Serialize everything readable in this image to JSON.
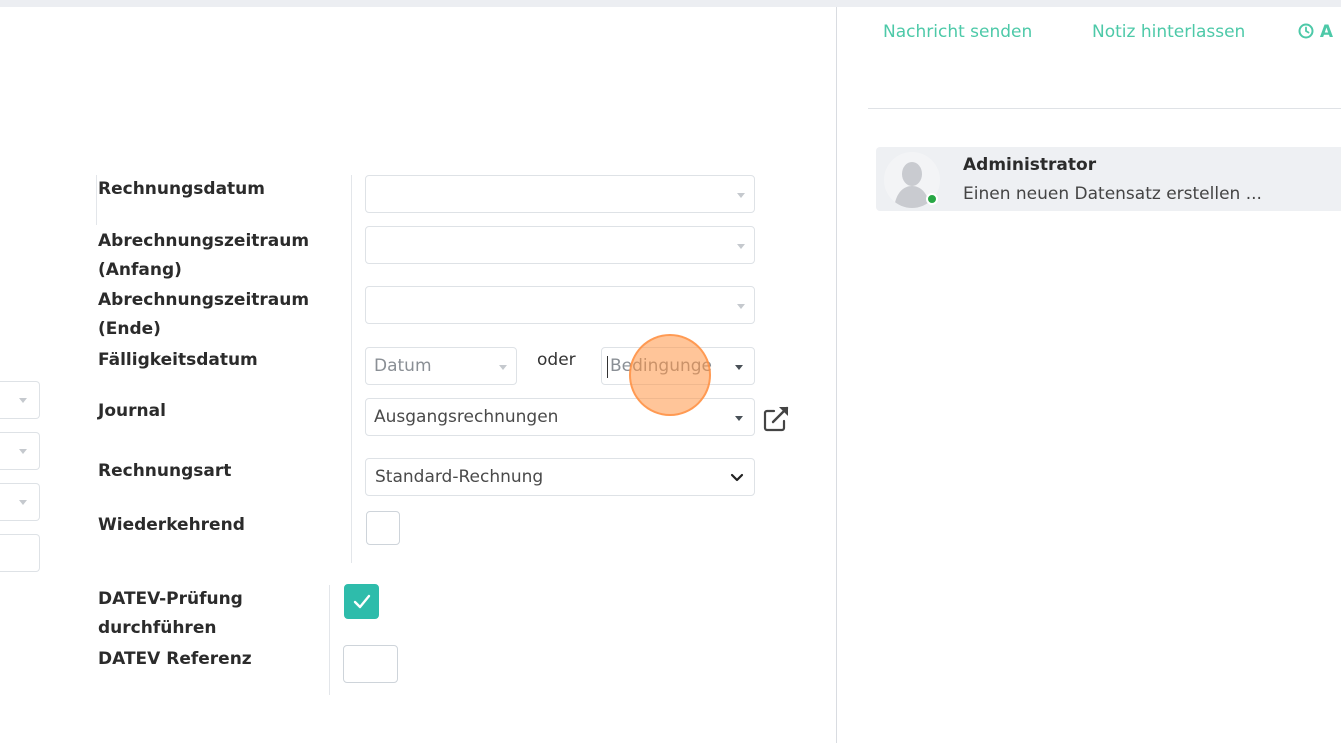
{
  "form": {
    "labels": {
      "invoice_date": "Rechnungsdatum",
      "period_start_1": "Abrechnungszeitraum",
      "period_start_2": "(Anfang)",
      "period_end_1": "Abrechnungszeitraum",
      "period_end_2": "(Ende)",
      "due_date": "Fälligkeitsdatum",
      "journal": "Journal",
      "invoice_type": "Rechnungsart",
      "recurring": "Wiederkehrend",
      "datev_check_1": "DATEV-Prüfung",
      "datev_check_2": "durchführen",
      "datev_ref": "DATEV Referenz"
    },
    "due_date": {
      "date_placeholder": "Datum",
      "or_text": "oder",
      "terms_placeholder": "Bedingunge"
    },
    "journal_value": "Ausgangsrechnungen",
    "invoice_type_value": "Standard-Rechnung",
    "recurring_checked": false,
    "datev_check_checked": true,
    "datev_ref_value": ""
  },
  "chatter": {
    "buttons": {
      "send_message": "Nachricht senden",
      "log_note": "Notiz hinterlassen",
      "activity": "A"
    },
    "messages": [
      {
        "author": "Administrator",
        "body": "Einen neuen Datensatz erstellen ..."
      }
    ]
  },
  "colors": {
    "accent": "#2ebcab",
    "chatter_link": "#4dc9a8",
    "online": "#28a745",
    "click_marker": "#ff9646"
  }
}
